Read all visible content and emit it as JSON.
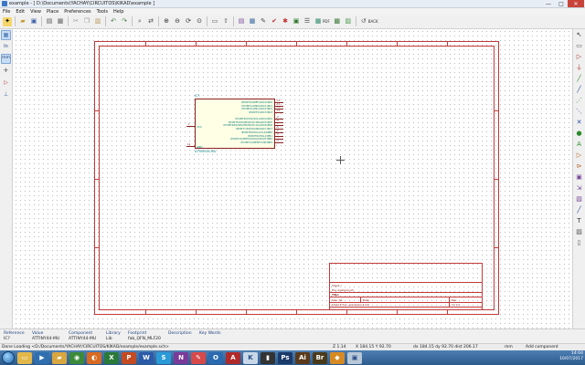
{
  "window": {
    "title": "example - [ D:\\Documents\\YACHAY\\CIRCUITOS\\KIKAD\\example ]",
    "minimize": "—",
    "maximize": "□",
    "close": "✕"
  },
  "menu": [
    "File",
    "Edit",
    "View",
    "Place",
    "Preferences",
    "Tools",
    "Help"
  ],
  "toolbar": {
    "pdf_label": "PDF",
    "back_label": "BACK"
  },
  "left_toolbar": {
    "units_in": "In",
    "units_mm": "mm"
  },
  "schematic": {
    "component_ref": "IC?",
    "component_value": "ATTINY44-MU",
    "right_pins": [
      {
        "label": "(PCINT0/AREF/ADC0)PA0",
        "num": "13"
      },
      {
        "label": "(PCINT1/AIN0/ADC1)PA1",
        "num": "12"
      },
      {
        "label": "(PCINT2/AIN1/ADC2)PA2",
        "num": "11"
      },
      {
        "label": "(PCINT3/ADC3)PA3",
        "num": "10"
      },
      {
        "label": "(PCINT4/USCK/SCL/ADC4)PA4",
        "num": "9"
      },
      {
        "label": "(PCINT5/DO/MISO/OC1B/ADC5)PA5",
        "num": "8"
      },
      {
        "label": "(PCINT6/DI/SDA/MOSI/OC1A/ADC6)PA6",
        "num": "7"
      },
      {
        "label": "(PCINT7/ICP/OC0B/ADC7)PA7",
        "num": "6"
      },
      {
        "label": "(PCINT8/XTAL1/CLKI)PB0",
        "num": "2"
      },
      {
        "label": "(PCINT9/XTAL2)PB1",
        "num": "3"
      },
      {
        "label": "(PCINT10/INT0/OC0A/CKOUT)PB2",
        "num": "5"
      },
      {
        "label": "(PCINT11/RESET/dW)PB3",
        "num": "4"
      }
    ],
    "left_pins": [
      {
        "label": "VCC",
        "num": "1"
      },
      {
        "label": "GND",
        "num": "14"
      }
    ]
  },
  "title_block": {
    "sheet": "Sheet: /",
    "file": "File: example.sch",
    "title_label": "Title:",
    "size": "Size: A4",
    "date": "Date:",
    "rev": "Rev:",
    "kicad": "KiCad E.D.A.  eeschema 4.0.6",
    "id": "Id: 1/1"
  },
  "properties": [
    {
      "key": "Reference",
      "value": "IC?"
    },
    {
      "key": "Value",
      "value": "ATTINY44-MU"
    },
    {
      "key": "Component",
      "value": "ATTINY44-MU"
    },
    {
      "key": "Library",
      "value": "Lib"
    },
    {
      "key": "Footprint",
      "value": "fab_QFN_MLF20"
    },
    {
      "key": "Description",
      "value": ""
    },
    {
      "key": "Key Words",
      "value": ""
    }
  ],
  "status": {
    "message": "Done Loading <D:/Documents/YACHAY/CIRCUITOS/KIKAD/example/example.sch>",
    "zoom": "Z 1.14",
    "xy": "X 184.15  Y 92.70",
    "delta": "dx 184.15  dy 92.70  dist 206.17",
    "units": "mm",
    "mode": "Add component"
  },
  "tray": {
    "time": "14:04",
    "date": "10/07/2017"
  }
}
